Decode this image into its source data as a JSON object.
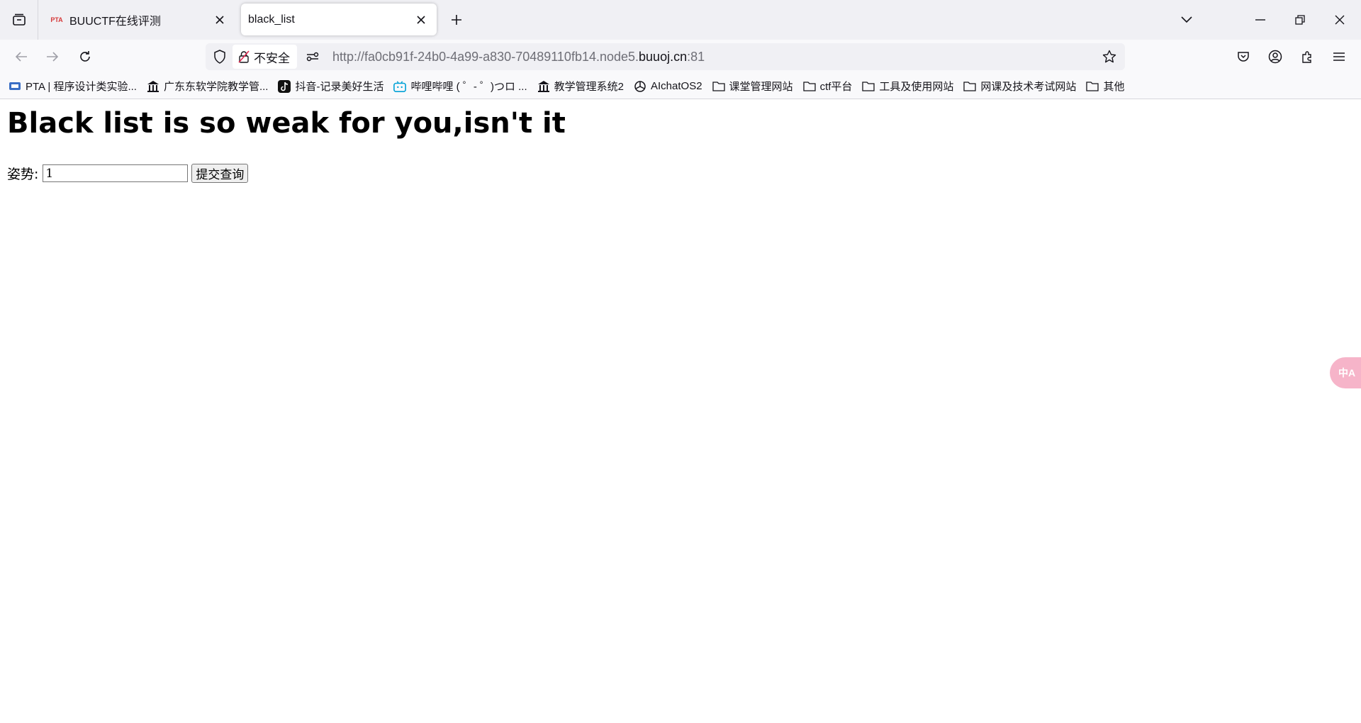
{
  "browser": {
    "tabs": [
      {
        "title": "BUUCTF在线评测",
        "favicon": "buuctf-icon",
        "active": false
      },
      {
        "title": "black_list",
        "favicon": "",
        "active": true
      }
    ],
    "address": {
      "security_label": "不安全",
      "url_prefix": "http://fa0cb91f-24b0-4a99-a830-70489110fb14.node5.",
      "url_domain": "buuoj.cn",
      "url_suffix": ":81"
    },
    "bookmarks": [
      {
        "label": "PTA | 程序设计类实验...",
        "icon": "pta-icon"
      },
      {
        "label": "广东东软学院教学管...",
        "icon": "school-icon"
      },
      {
        "label": "抖音-记录美好生活",
        "icon": "douyin-icon"
      },
      {
        "label": "哔哩哔哩 ( ゜- ゜)つロ ...",
        "icon": "bilibili-icon"
      },
      {
        "label": "教学管理系统2",
        "icon": "school-icon"
      },
      {
        "label": "AIchatOS2",
        "icon": "openai-icon"
      },
      {
        "label": "课堂管理网站",
        "icon": "folder-icon"
      },
      {
        "label": "ctf平台",
        "icon": "folder-icon"
      },
      {
        "label": "工具及使用网站",
        "icon": "folder-icon"
      },
      {
        "label": "网课及技术考试网站",
        "icon": "folder-icon"
      },
      {
        "label": "其他",
        "icon": "folder-icon"
      }
    ]
  },
  "page": {
    "heading": "Black list is so weak for you,isn't it",
    "form": {
      "label": "姿势:",
      "input_value": "1",
      "submit_label": "提交查询"
    }
  },
  "translate_fab": {
    "label": "中A"
  }
}
